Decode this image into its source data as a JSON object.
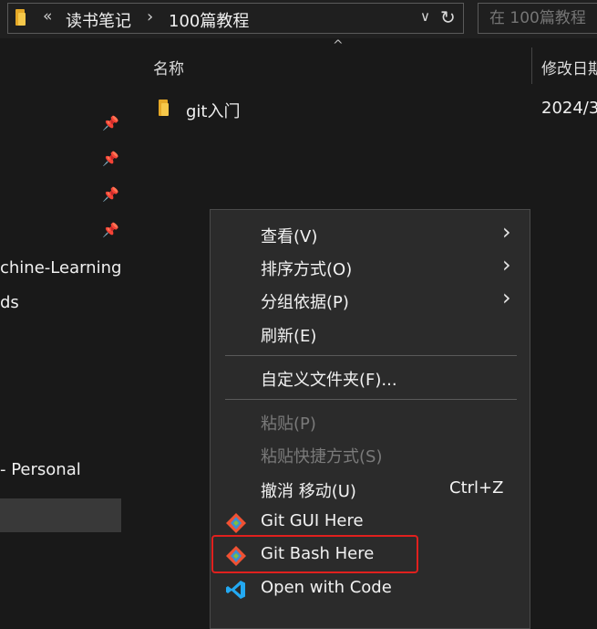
{
  "addressbar": {
    "overflow": "«",
    "crumbs": [
      "读书笔记",
      "100篇教程"
    ],
    "separator": "›",
    "history": "∨",
    "refresh": "↻"
  },
  "search": {
    "placeholder": "在 100篇教程"
  },
  "nav": {
    "items": [
      "chine-Learning",
      "ds",
      "- Personal"
    ],
    "pin": "📌"
  },
  "content": {
    "columns": {
      "name": "名称",
      "modified": "修改日期"
    },
    "sort_arrow": "^",
    "files": [
      {
        "name": "git入门",
        "date": "2024/3"
      }
    ]
  },
  "context_menu": {
    "arrow": "›",
    "items": [
      {
        "label": "查看(V)"
      },
      {
        "label": "排序方式(O)"
      },
      {
        "label": "分组依据(P)"
      },
      {
        "label": "刷新(E)"
      },
      {
        "label": "自定义文件夹(F)..."
      },
      {
        "label": "粘贴(P)"
      },
      {
        "label": "粘贴快捷方式(S)"
      },
      {
        "label": "撤消 移动(U)",
        "shortcut": "Ctrl+Z"
      },
      {
        "label": "Git GUI Here",
        "icon": "git-icon"
      },
      {
        "label": "Git Bash Here",
        "icon": "git-icon"
      },
      {
        "label": "Open with Code",
        "icon": "vscode-icon"
      }
    ]
  },
  "colors": {
    "background": "#191919",
    "menu_background": "#2b2b2b",
    "highlight_border": "#e0201e",
    "folder": "#f6c84a",
    "vscode_blue": "#23a9f2"
  }
}
